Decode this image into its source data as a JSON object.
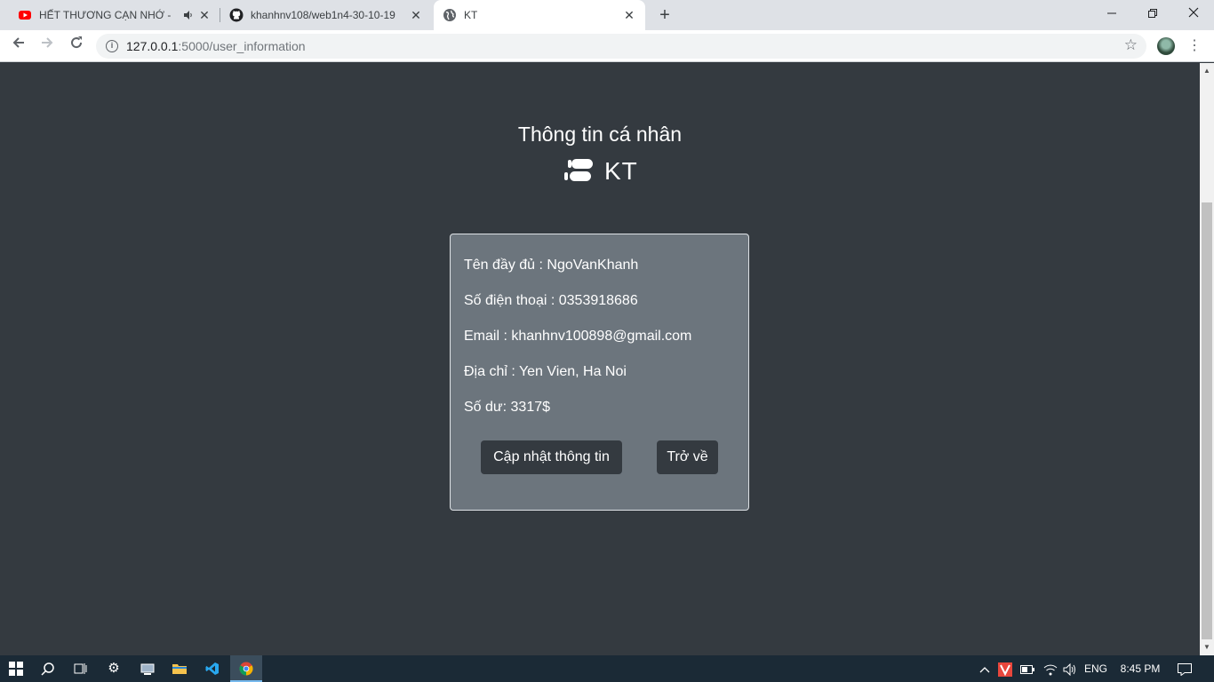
{
  "browser": {
    "tabs": [
      {
        "title": "HẾT THƯƠNG CẠN NHỚ - Đ",
        "icon": "youtube-icon",
        "audio_icon": "speaker-icon",
        "active": false
      },
      {
        "title": "khanhnv108/web1n4-30-10-19",
        "icon": "github-icon",
        "active": false
      },
      {
        "title": "KT",
        "icon": "globe-icon",
        "active": true
      }
    ],
    "close_glyph": "✕",
    "new_tab_glyph": "+",
    "url_host": "127.0.0.1",
    "url_path": ":5000/user_information"
  },
  "page": {
    "title": "Thông tin cá nhân",
    "brand": "KT",
    "fields": {
      "fullname": "Tên đầy đủ : NgoVanKhanh",
      "phone": "Số điện thoại : 0353918686",
      "email": "Email : khanhnv100898@gmail.com",
      "address": "Địa chỉ : Yen Vien, Ha Noi",
      "balance": "Số dư: 3317$"
    },
    "buttons": {
      "update": "Cập nhật thông tin",
      "back": "Trở về"
    }
  },
  "taskbar": {
    "language": "ENG",
    "time": "8:45 PM"
  },
  "colors": {
    "page_bg": "#343a40",
    "card_bg": "#6c757d",
    "button_bg": "#343a40",
    "text": "#ffffff"
  }
}
